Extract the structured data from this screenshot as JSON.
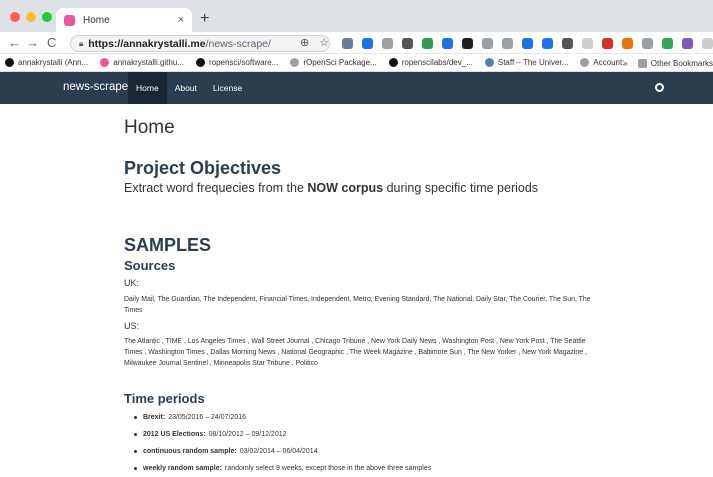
{
  "browser": {
    "tab_title": "Home",
    "tab_close": "×",
    "new_tab": "+",
    "nav": {
      "back": "←",
      "forward": "→",
      "reload": "C"
    },
    "url_host": "https://annakrystalli.me",
    "url_path": "/news-scrape/",
    "omni_zoom": "⊕",
    "omni_star": "☆",
    "extensions": [
      "#6b7c93",
      "#1a73e8",
      "#9aa0a6",
      "#555555",
      "#2e9c4f",
      "#1a73e8",
      "#202124",
      "#9aa0a6",
      "#9aa0a6",
      "#1a73e8",
      "#1a73e8",
      "#555555",
      "#cfcfcf",
      "#d93025",
      "#e8710a",
      "#9aa0a6",
      "#34a853",
      "#7e57c2",
      "#cccccc",
      "#f4b400"
    ]
  },
  "bookmarks": {
    "items": [
      {
        "label": "annakrystalli (Ann...",
        "color": "#111111"
      },
      {
        "label": "annakrystalli.githu...",
        "color": "#e8589a"
      },
      {
        "label": "ropensci/software...",
        "color": "#111111"
      },
      {
        "label": "rOpenSci Package...",
        "color": "#9aa0a6"
      },
      {
        "label": "ropenscilabs/dev_...",
        "color": "#111111"
      },
      {
        "label": "Staff – The Univer...",
        "color": "#5b7ea6"
      },
      {
        "label": "Account:",
        "color": "#9aa0a6"
      }
    ],
    "more": "»",
    "other": "Other Bookmarks"
  },
  "site": {
    "brand": "news-scrape",
    "links": [
      "Home",
      "About",
      "License"
    ]
  },
  "page": {
    "title": "Home",
    "objectives_heading": "Project Objectives",
    "objectives_pre": "Extract word frequecies from the ",
    "objectives_bold": "NOW corpus",
    "objectives_post": " during specific time periods",
    "samples_heading": "SAMPLES",
    "sources_heading": "Sources",
    "uk_label": "UK:",
    "uk_sources": "Daily Mail, The Guardian, The Independent, Financial Times, Independent, Metro, Evening Standard, The National, Daily Star, The Courier, The Sun, The Times",
    "us_label": "US:",
    "us_sources": "The Atlantic , TIME , Los Angeles Times , Wall Street Journal , Chicago Tribune , New York Daily News , Washington Post , New York Post , The Seattle Times , Washington Times , Dallas Morning News , National Geographic , The Week Magazine , Baltimore Sun , The New Yorker , New York Magazine , Milwaukee Journal Sentinel , Minneapolis Star Tribune , Politico",
    "time_heading": "Time periods",
    "periods": [
      {
        "name": "Brexit:",
        "value": "23/05/2016 – 24/07/2016"
      },
      {
        "name": "2012 US Elections:",
        "value": "08/10/2012 – 09/12/2012"
      },
      {
        "name": "continuous random sample:",
        "value": "03/02/2014 – 06/04/2014"
      },
      {
        "name": "weekly random sample:",
        "value": "randomly select 9 weeks, except those in the above three samples"
      }
    ]
  }
}
